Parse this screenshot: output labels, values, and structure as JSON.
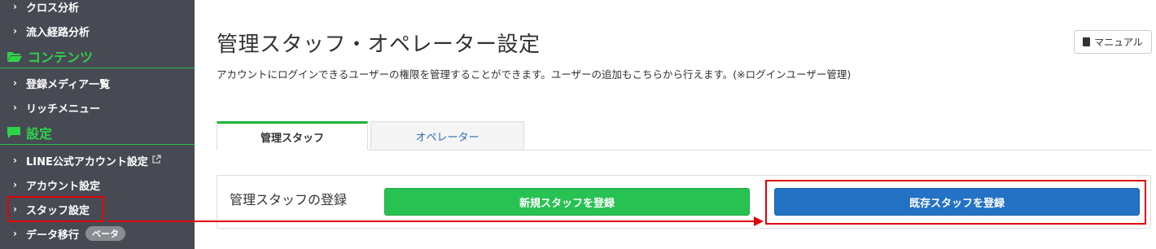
{
  "sidebar": {
    "items_top": [
      "クロス分析",
      "流入経路分析"
    ],
    "section_contents": "コンテンツ",
    "items_contents": [
      "登録メディア一覧",
      "リッチメニュー"
    ],
    "section_settings": "設定",
    "items_settings": [
      "LINE公式アカウント設定",
      "アカウント設定",
      "スタッフ設定",
      "データ移行"
    ],
    "beta_badge": "ベータ"
  },
  "header": {
    "title": "管理スタッフ・オペレーター設定",
    "description": "アカウントにログインできるユーザーの権限を管理することができます。ユーザーの追加もこちらから行えます。(※ログインユーザー管理)",
    "manual_label": "マニュアル"
  },
  "tabs": [
    {
      "label": "管理スタッフ",
      "active": true
    },
    {
      "label": "オペレーター",
      "active": false
    }
  ],
  "registration": {
    "title": "管理スタッフの登録",
    "new_button": "新規スタッフを登録",
    "existing_button": "既存スタッフを登録"
  },
  "colors": {
    "sidebar_bg": "#474a53",
    "section_green": "#2dd44a",
    "tab_active_border": "#1cb33b",
    "new_button": "#28c252",
    "existing_button": "#2372c4",
    "highlight_red": "#e0000b"
  }
}
